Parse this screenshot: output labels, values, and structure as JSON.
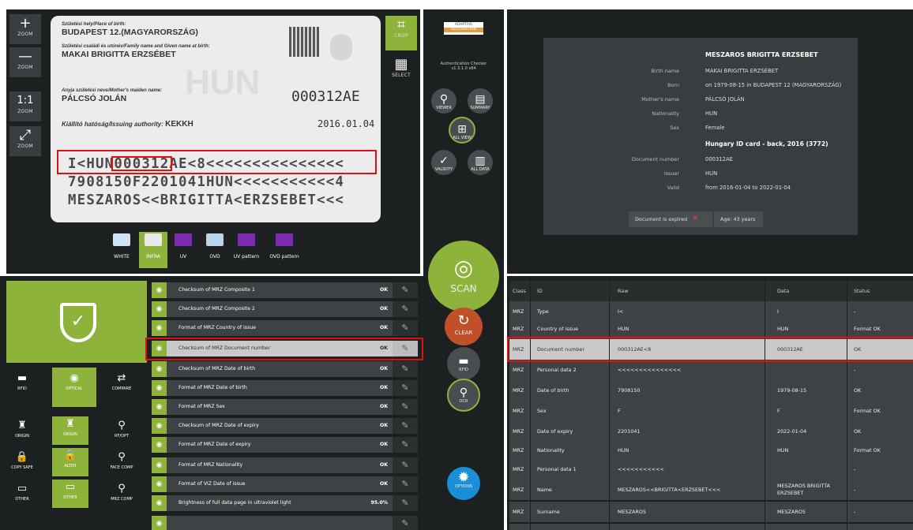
{
  "toolbar_left": [
    {
      "icon": "+",
      "label": "ZOOM"
    },
    {
      "icon": "—",
      "label": "ZOOM"
    },
    {
      "icon": "1:1",
      "label": "ZOOM"
    },
    {
      "icon": "⤢",
      "label": "ZOOM"
    }
  ],
  "toolbar_right": [
    {
      "icon": "⌗",
      "label": "CROP"
    },
    {
      "icon": "▦",
      "label": "SELECT"
    }
  ],
  "card": {
    "place_label": "Születési hely/Place of birth:",
    "place_value": "BUDAPEST 12.(MAGYARORSZÁG)",
    "name_label": "Születési családi és utónév/Family name and Given name at birth:",
    "name_value": "MAKAI BRIGITTA ERZSÉBET",
    "mother_label": "Anyja születési neve/Mother's maiden name:",
    "mother_value": "PÁLCSÓ JOLÁN",
    "authority_label": "Kiállító hatóság/Issuing authority:",
    "authority_value": "KEKKH",
    "doc_number": "000312AE",
    "date": "2016.01.04",
    "watermark": "HUN",
    "mrz1": "I<HUN000312AE<8<<<<<<<<<<<<<<<",
    "mrz2": "7908150F2201041HUN<<<<<<<<<<<4",
    "mrz3": "MESZAROS<<BRIGITTA<ERZSEBET<<<"
  },
  "light_tabs": [
    {
      "label": "WHITE",
      "color": "#cfe3f5"
    },
    {
      "label": "INFRA",
      "color": "#e8e8e8"
    },
    {
      "label": "UV",
      "color": "#7c2bb0"
    },
    {
      "label": "OVD",
      "color": "#bcd6ef"
    },
    {
      "label": "UV pattern",
      "color": "#7c2bb0"
    },
    {
      "label": "OVD pattern",
      "color": "#7c2bb0"
    }
  ],
  "brand": {
    "line1": "ADAPTIVE",
    "line2": "RECOGNITION",
    "app": "Authentication Checker v1.3.1.0 x64"
  },
  "nav": {
    "viewer": "VIEWER",
    "summary": "SUMMARY",
    "all_view": "ALL VIEW",
    "validity": "VALIDITY",
    "all_data": "ALL DATA"
  },
  "actions": {
    "scan": "SCAN",
    "clear": "CLEAR",
    "rfid": "RFID",
    "ocr": "OCR",
    "options": "OPTIONS"
  },
  "summary": {
    "title": "MESZAROS BRIGITTA ERZSEBET",
    "rows": [
      {
        "label": "Birth name",
        "value": "MAKAI BRIGITTA ERZSÉBET"
      },
      {
        "label": "Born",
        "value": "on 1979-08-15 in BUDAPEST 12 (MAGYARORSZÁG)"
      },
      {
        "label": "Mother's name",
        "value": "PÁLCSÓ JOLÁN"
      },
      {
        "label": "Nationality",
        "value": "HUN"
      },
      {
        "label": "Sex",
        "value": "Female"
      }
    ],
    "doc_title": "Hungary ID card - back, 2016 (3772)",
    "doc_rows": [
      {
        "label": "Document number",
        "value": "000312AE"
      },
      {
        "label": "Issuer",
        "value": "HUN"
      },
      {
        "label": "Valid",
        "value": "from 2016-01-04 to 2022-01-04"
      }
    ],
    "expired": "Document is expired",
    "age": "Age: 43 years"
  },
  "left_modes": [
    {
      "icon": "▬",
      "label": "RFID"
    },
    {
      "icon": "◉",
      "label": "OPTICAL"
    },
    {
      "icon": "⇄",
      "label": "COMPARE"
    }
  ],
  "left_tools": [
    {
      "icon": "♜",
      "label": "ORIGIN"
    },
    {
      "icon": "♜",
      "label": "ORIGIN"
    },
    {
      "icon": "⚲",
      "label": "RF/OPT"
    },
    {
      "icon": "🔒",
      "label": "COPY SAFE"
    },
    {
      "icon": "🔒",
      "label": "ALTER"
    },
    {
      "icon": "⚲",
      "label": "FACE COMP"
    },
    {
      "icon": "▭",
      "label": "OTHER"
    },
    {
      "icon": "▭",
      "label": "OTHER"
    },
    {
      "icon": "⚲",
      "label": "MRZ COMP"
    }
  ],
  "checks": [
    {
      "name": "Checksum of MRZ Composite 1",
      "status": "OK"
    },
    {
      "name": "Checksum of MRZ Composite 2",
      "status": "OK"
    },
    {
      "name": "Format of MRZ Country of issue",
      "status": "OK"
    },
    {
      "name": "Checksum of MRZ Document number",
      "status": "OK"
    },
    {
      "name": "Checksum of MRZ Date of birth",
      "status": "OK"
    },
    {
      "name": "Format of MRZ Date of birth",
      "status": "OK"
    },
    {
      "name": "Format of MRZ Sex",
      "status": "OK"
    },
    {
      "name": "Checksum of MRZ Date of expiry",
      "status": "OK"
    },
    {
      "name": "Format of MRZ Date of expiry",
      "status": "OK"
    },
    {
      "name": "Format of MRZ Nationality",
      "status": "OK"
    },
    {
      "name": "Format of VIZ Date of issue",
      "status": "OK"
    },
    {
      "name": "Brightness of full data page in ultraviolet light",
      "status": "95.0%"
    }
  ],
  "table": {
    "headers": [
      "Class",
      "ID",
      "Raw",
      "Data",
      "Status"
    ],
    "rows": [
      [
        "MRZ",
        "Type",
        "I<",
        "I",
        "-"
      ],
      [
        "MRZ",
        "Country of issue",
        "HUN",
        "HUN",
        "Format OK"
      ],
      [
        "MRZ",
        "Document number",
        "000312AE<8",
        "000312AE",
        "OK"
      ],
      [
        "MRZ",
        "Personal data 2",
        "<<<<<<<<<<<<<<<",
        "",
        "-"
      ],
      [
        "MRZ",
        "Date of birth",
        "7908150",
        "1979-08-15",
        "OK"
      ],
      [
        "MRZ",
        "Sex",
        "F",
        "F",
        "Format OK"
      ],
      [
        "MRZ",
        "Date of expiry",
        "2201041",
        "2022-01-04",
        "OK"
      ],
      [
        "MRZ",
        "Nationality",
        "HUN",
        "HUN",
        "Format OK"
      ],
      [
        "MRZ",
        "Personal data 1",
        "<<<<<<<<<<<",
        "",
        "-"
      ],
      [
        "MRZ",
        "Name",
        "MESZAROS<<BRIGITTA<ERZSEBET<<<",
        "MESZAROS BRIGITTA ERZSEBET",
        "-"
      ],
      [
        "MRZ",
        "Surname",
        "MESZAROS",
        "MESZAROS",
        "-"
      ]
    ]
  },
  "colors": {
    "accent": "#8db33a",
    "clear": "#c0502a",
    "options": "#1a8fd8",
    "highlight": "#e01010"
  }
}
